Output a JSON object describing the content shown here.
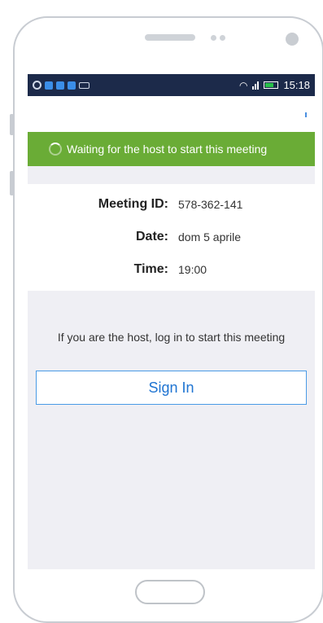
{
  "app": {
    "status_bar": {
      "time": "15:18"
    },
    "waiting_banner": {
      "text": "Waiting for the host to start this meeting"
    },
    "meeting": {
      "id_label": "Meeting ID:",
      "id_value": "578-362-141",
      "date_label": "Date:",
      "date_value": "dom 5 aprile",
      "time_label": "Time:",
      "time_value": "19:00"
    },
    "host_hint": "If you are the host, log in to start this meeting",
    "sign_in_label": "Sign In"
  },
  "icons": [
    "wifi-icon",
    "signal-bars-icon",
    "battery-icon",
    "spinner-icon"
  ],
  "colors": {
    "status_bar": "#1c2a4a",
    "banner": "#6aac36",
    "sign_in_border": "#4a9be6",
    "sign_in_text": "#1f74d2"
  }
}
